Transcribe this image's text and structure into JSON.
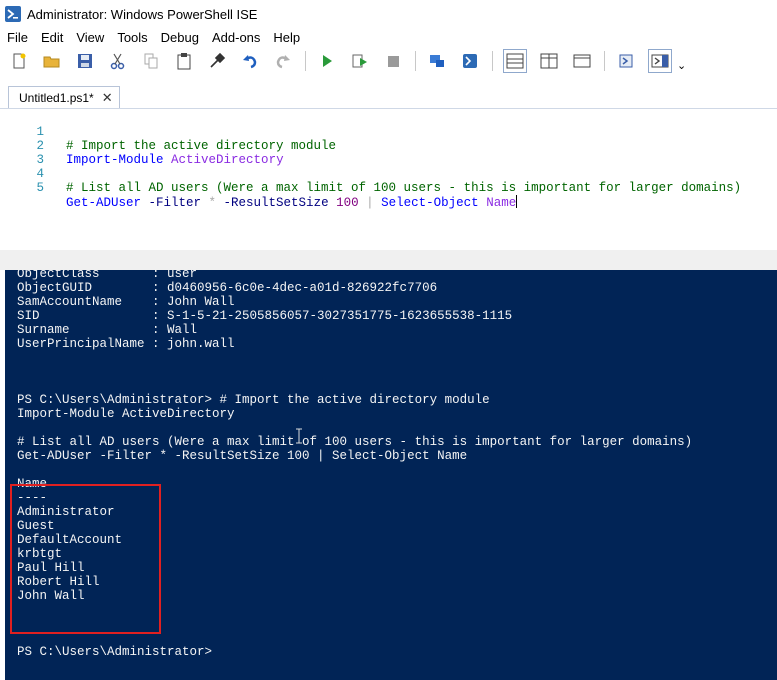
{
  "window": {
    "title": "Administrator: Windows PowerShell ISE",
    "icon": "powershell-icon"
  },
  "menu": [
    "File",
    "Edit",
    "View",
    "Tools",
    "Debug",
    "Add-ons",
    "Help"
  ],
  "toolbar": {
    "icons": [
      "new-file-icon",
      "open-folder-icon",
      "save-icon",
      "cut-icon",
      "copy-icon",
      "paste-icon",
      "clear-icon",
      "undo-icon",
      "redo-icon",
      "run-icon",
      "run-selection-icon",
      "stop-icon",
      "remote-icon",
      "powershell-console-icon",
      "layout-top-icon",
      "layout-right-icon",
      "layout-max-icon",
      "show-command-icon",
      "show-addon-icon"
    ],
    "overflow": "⌄"
  },
  "tab": {
    "label": "Untitled1.ps1*",
    "close": "✕"
  },
  "editor": {
    "lines": [
      {
        "num": "1",
        "parts": [
          {
            "t": "# Import the active directory module",
            "c": "comment"
          }
        ]
      },
      {
        "num": "2",
        "parts": [
          {
            "t": "Import-Module",
            "c": "cmdlet"
          },
          {
            "t": " ",
            "c": ""
          },
          {
            "t": "ActiveDirectory",
            "c": "arg"
          }
        ]
      },
      {
        "num": "3",
        "parts": []
      },
      {
        "num": "4",
        "parts": [
          {
            "t": "# List all AD users (Were a max limit of 100 users - this is important for larger domains)",
            "c": "comment"
          }
        ]
      },
      {
        "num": "5",
        "parts": [
          {
            "t": "Get-ADUser",
            "c": "cmdlet"
          },
          {
            "t": " -Filter ",
            "c": "param"
          },
          {
            "t": "*",
            "c": "op"
          },
          {
            "t": " -ResultSetSize ",
            "c": "param"
          },
          {
            "t": "100",
            "c": "num"
          },
          {
            "t": " ",
            "c": ""
          },
          {
            "t": "|",
            "c": "op"
          },
          {
            "t": " ",
            "c": ""
          },
          {
            "t": "Select-Object",
            "c": "cmdlet"
          },
          {
            "t": " ",
            "c": ""
          },
          {
            "t": "Name",
            "c": "arg"
          }
        ]
      }
    ]
  },
  "console": {
    "lines": [
      "ObjectClass       : user",
      "ObjectGUID        : d0460956-6c0e-4dec-a01d-826922fc7706",
      "SamAccountName    : John Wall",
      "SID               : S-1-5-21-2505856057-3027351775-1623655538-1115",
      "Surname           : Wall",
      "UserPrincipalName : john.wall",
      "",
      "",
      "",
      "PS C:\\Users\\Administrator> # Import the active directory module",
      "Import-Module ActiveDirectory",
      "",
      "# List all AD users (Were a max limit of 100 users - this is important for larger domains)",
      "Get-ADUser -Filter * -ResultSetSize 100 | Select-Object Name",
      "",
      "Name",
      "----",
      "Administrator",
      "Guest",
      "DefaultAccount",
      "krbtgt",
      "Paul Hill",
      "Robert Hill",
      "John Wall",
      "",
      "",
      "",
      "PS C:\\Users\\Administrator>"
    ]
  }
}
